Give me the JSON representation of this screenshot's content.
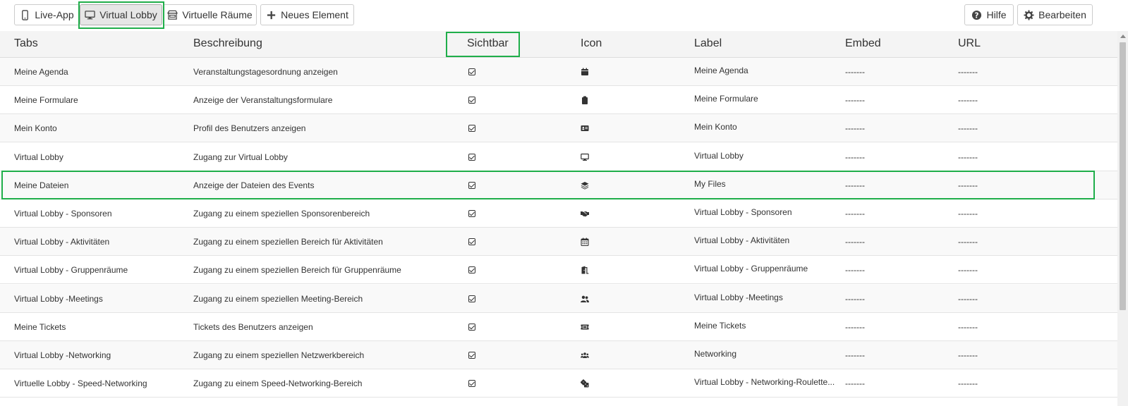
{
  "toolbar": {
    "live_app": "Live-App",
    "virtual_lobby": "Virtual Lobby",
    "virtuelle_raeume": "Virtuelle Räume",
    "neues_element": "Neues Element",
    "hilfe": "Hilfe",
    "bearbeiten": "Bearbeiten"
  },
  "table": {
    "headers": {
      "tabs": "Tabs",
      "beschreibung": "Beschreibung",
      "sichtbar": "Sichtbar",
      "icon": "Icon",
      "label": "Label",
      "embed": "Embed",
      "url": "URL"
    },
    "rows": [
      {
        "tab": "Meine Agenda",
        "desc": "Veranstaltungstagesordnung anzeigen",
        "visible": true,
        "icon": "calendar-icon",
        "label": "Meine Agenda",
        "embed": "-------",
        "url": "-------"
      },
      {
        "tab": "Meine Formulare",
        "desc": "Anzeige der Veranstaltungsformulare",
        "visible": true,
        "icon": "clipboard-icon",
        "label": "Meine Formulare",
        "embed": "-------",
        "url": "-------"
      },
      {
        "tab": "Mein Konto",
        "desc": "Profil des Benutzers anzeigen",
        "visible": true,
        "icon": "id-card-icon",
        "label": "Mein Konto",
        "embed": "-------",
        "url": "-------"
      },
      {
        "tab": "Virtual Lobby",
        "desc": "Zugang zur Virtual Lobby",
        "visible": true,
        "icon": "desktop-icon",
        "label": "Virtual Lobby",
        "embed": "-------",
        "url": "-------"
      },
      {
        "tab": "Meine Dateien",
        "desc": "Anzeige der Dateien des Events",
        "visible": true,
        "icon": "layers-icon",
        "label": "My Files",
        "embed": "-------",
        "url": "-------"
      },
      {
        "tab": "Virtual Lobby - Sponsoren",
        "desc": "Zugang zu einem speziellen Sponsorenbereich",
        "visible": true,
        "icon": "handshake-icon",
        "label": "Virtual Lobby - Sponsoren",
        "embed": "-------",
        "url": "-------"
      },
      {
        "tab": "Virtual Lobby - Aktivitäten",
        "desc": "Zugang zu einem speziellen Bereich für Aktivitäten",
        "visible": true,
        "icon": "calendar-grid-icon",
        "label": "Virtual Lobby - Aktivitäten",
        "embed": "-------",
        "url": "-------"
      },
      {
        "tab": "Virtual Lobby - Gruppenräume",
        "desc": "Zugang zu einem speziellen Bereich für Gruppenräume",
        "visible": true,
        "icon": "door-open-icon",
        "label": "Virtual Lobby - Gruppenräume",
        "embed": "-------",
        "url": "-------"
      },
      {
        "tab": "Virtual Lobby -Meetings",
        "desc": "Zugang zu einem speziellen Meeting-Bereich",
        "visible": true,
        "icon": "user-friends-icon",
        "label": "Virtual Lobby -Meetings",
        "embed": "-------",
        "url": "-------"
      },
      {
        "tab": "Meine Tickets",
        "desc": "Tickets des Benutzers anzeigen",
        "visible": true,
        "icon": "ticket-icon",
        "label": "Meine Tickets",
        "embed": "-------",
        "url": "-------"
      },
      {
        "tab": "Virtual Lobby -Networking",
        "desc": "Zugang zu einem speziellen Netzwerkbereich",
        "visible": true,
        "icon": "users-icon",
        "label": "Networking",
        "embed": "-------",
        "url": "-------"
      },
      {
        "tab": "Virtuelle Lobby - Speed-Networking",
        "desc": "Zugang zu einem Speed-Networking-Bereich",
        "visible": true,
        "icon": "dice-icon",
        "label": "Virtual Lobby - Networking-Roulette...",
        "embed": "-------",
        "url": "-------"
      }
    ]
  }
}
